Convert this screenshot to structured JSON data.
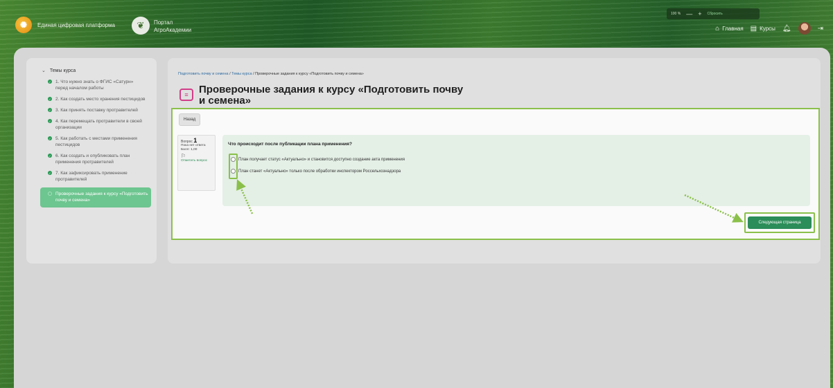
{
  "header": {
    "brand": "Единая цифровая платформа",
    "portal_line1": "Портал",
    "portal_line2": "АгроАкадемии",
    "zoom": {
      "level": "100 %",
      "minus": "—",
      "plus": "+",
      "reset": "Сбросить"
    },
    "nav": {
      "home": "Главная",
      "courses": "Курсы"
    }
  },
  "sidebar": {
    "heading": "Темы курса",
    "topics": [
      {
        "label": "1. Что нужно знать о ФГИС «Сатурн» перед началом работы",
        "done": true
      },
      {
        "label": "2. Как создать место хранения пестицидов",
        "done": true
      },
      {
        "label": "3. Как принять поставку протравителей",
        "done": true
      },
      {
        "label": "4. Как перемещать протравители в своей организации",
        "done": true
      },
      {
        "label": "5. Как работать с местами применения пестицидов",
        "done": true
      },
      {
        "label": "6. Как создать и опубликовать план применения протравителей",
        "done": true
      },
      {
        "label": "7. Как зафиксировать применение протравителей",
        "done": true
      },
      {
        "label": "Проверочные задания к курсу «Подготовить почву и семена»",
        "done": false,
        "active": true
      }
    ]
  },
  "breadcrumb": {
    "item1": "Подготовить почву и семена",
    "sep": "/",
    "item2": "Темы курса",
    "item3": "Проверочные задания к курсу «Подготовить почву и семена»"
  },
  "page": {
    "title": "Проверочные задания к курсу «Подготовить почву и семена»",
    "back_label": "Назад",
    "next_label": "Следующая страница"
  },
  "question": {
    "label": "Вопрос",
    "number": "1",
    "status": "Пока нет ответа",
    "score": "Балл: 1,00",
    "flag_label": "Отметить вопрос",
    "text": "Что происходит после публикации плана применения?",
    "answers": [
      "План получает статус «Актуально» и становится доступно создание акта применения",
      "План станет «Актуально» только после обработки инспектором Россельхознадзора"
    ]
  },
  "colors": {
    "accent_green": "#2b8d59",
    "highlight_green": "#8ac04a",
    "title_icon": "#d23d88"
  }
}
